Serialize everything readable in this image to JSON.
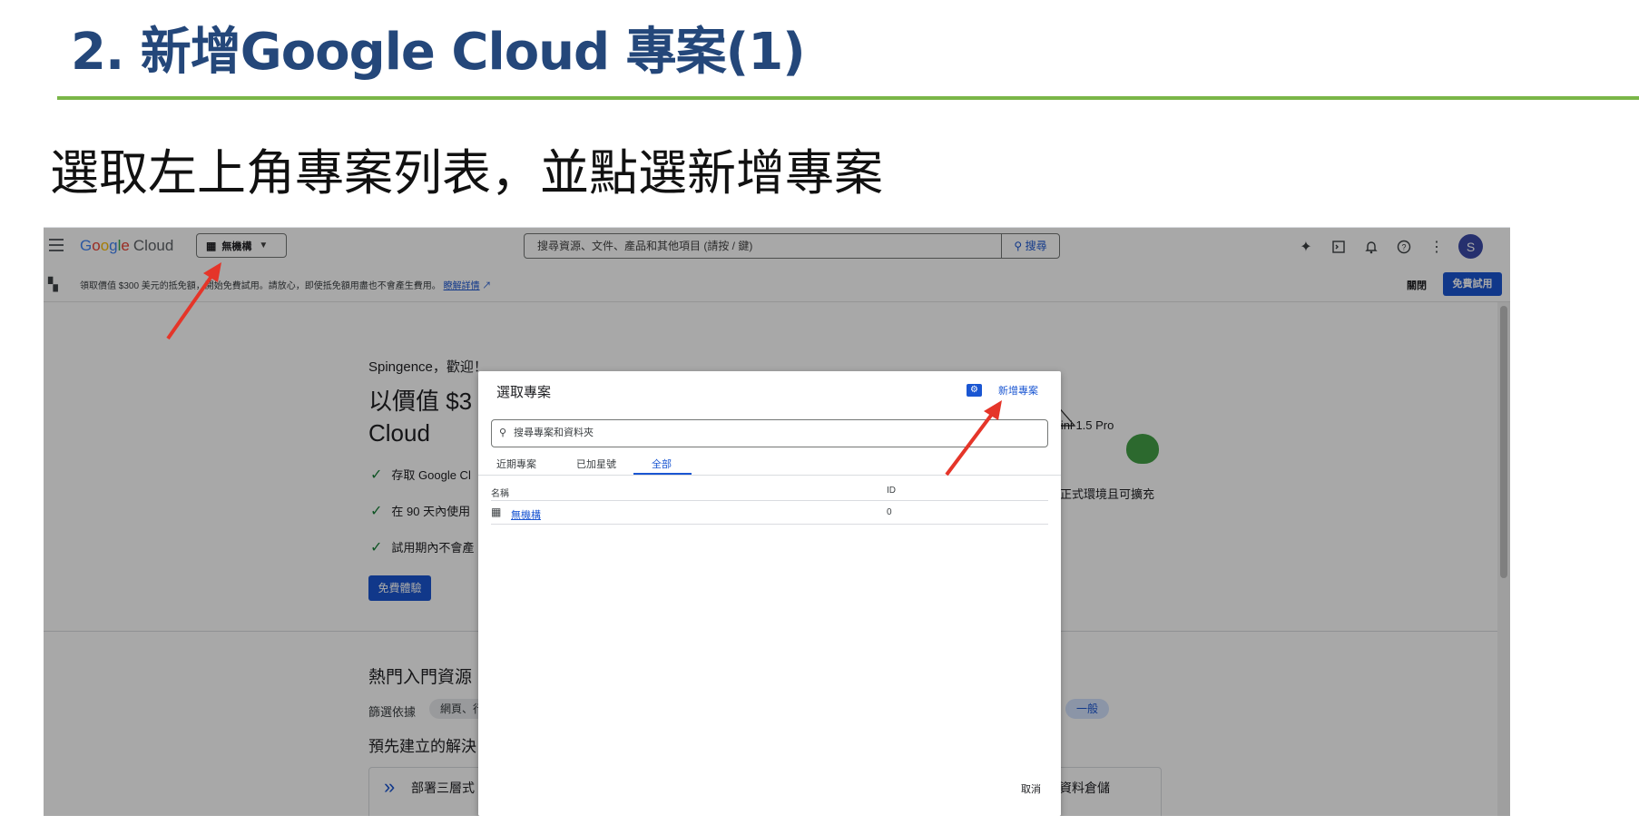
{
  "slide": {
    "title": "2. 新增Google Cloud 專案(1)",
    "subtitle": "選取左上角專案列表，並點選新增專案"
  },
  "topbar": {
    "logo": {
      "g1": "G",
      "o1": "o",
      "o2": "o",
      "g2": "g",
      "l": "l",
      "e": "e",
      "cloud": "Cloud"
    },
    "project_picker_label": "無機構",
    "search_placeholder": "搜尋資源、文件、產品和其他項目 (請按 / 鍵)",
    "search_button": "搜尋",
    "avatar_letter": "S"
  },
  "banner": {
    "text": "領取價值 $300 美元的抵免額，開始免費試用。請放心，即使抵免額用盡也不會產生費用。",
    "link": "瞭解詳情",
    "close": "關閉",
    "trial_button": "免費試用"
  },
  "welcome": {
    "greeting": "Spingence，歡迎！",
    "hero": "以價值 $3\nCloud",
    "checks": [
      "存取 Google Cl",
      "在 90 天內使用",
      "試用期內不會產"
    ],
    "free_button": "免費體驗",
    "right_text_1": "mini 1.5 Pro",
    "right_text_2": "正式環境且可擴充"
  },
  "resources": {
    "title": "熱門入門資源",
    "filter_label": "篩選依據",
    "chip_1": "網頁、行",
    "chip_general": "一般",
    "prebuilt_title": "預先建立的解決",
    "card_left": "部署三層式",
    "card_right": "資料倉儲"
  },
  "dialog": {
    "title": "選取專案",
    "new_project": "新增專案",
    "search_placeholder": "搜尋專案和資料夾",
    "tabs": [
      "近期專案",
      "已加星號",
      "全部"
    ],
    "active_tab": "全部",
    "columns": {
      "name": "名稱",
      "id": "ID"
    },
    "rows": [
      {
        "name": "無機構",
        "id": "0"
      }
    ],
    "cancel": "取消"
  },
  "colors": {
    "title_blue": "#24477a",
    "rule_green": "#7ab648",
    "accent_blue": "#1a56d2",
    "arrow_red": "#e53529"
  },
  "icons": {
    "hamburger": "menu-icon",
    "building": "building-icon",
    "search": "search-icon",
    "sparkle": "gemini-icon",
    "terminal": "cloud-shell-icon",
    "bell": "notifications-icon",
    "help": "help-icon",
    "more": "more-vert-icon",
    "gift": "gift-icon",
    "external": "external-link-icon",
    "folder_gear": "manage-resources-icon"
  }
}
